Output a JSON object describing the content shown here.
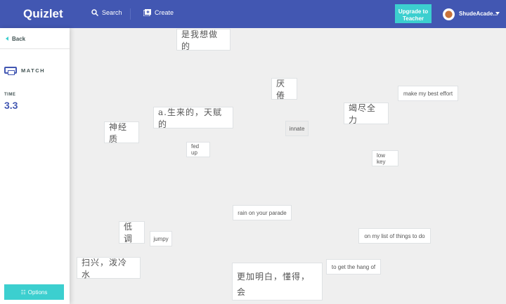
{
  "header": {
    "logo": "Quizlet",
    "search": "Search",
    "create": "Create",
    "upgrade": "Upgrade to Teacher",
    "username": "ShudeAcade..."
  },
  "sidebar": {
    "back": "Back",
    "mode": "MATCH",
    "time_label": "TIME",
    "time_value": "3.3",
    "options": "Options"
  },
  "cards": [
    {
      "text": "是我想做的"
    },
    {
      "text": "厌倦"
    },
    {
      "text": "a.生来的，天赋的"
    },
    {
      "text": "竭尽全力"
    },
    {
      "text": "make my best effort"
    },
    {
      "text": "innate"
    },
    {
      "text": "神经质"
    },
    {
      "text": "fed up"
    },
    {
      "text": "low key"
    },
    {
      "text": "rain on your parade"
    },
    {
      "text": "低调"
    },
    {
      "text": "jumpy"
    },
    {
      "text": "on my list of things to do"
    },
    {
      "text": "扫兴，泼冷水"
    },
    {
      "text": "更加明白，懂得，会"
    },
    {
      "text": "to get the hang of"
    }
  ],
  "colors": {
    "brand": "#4257b2",
    "accent": "#3ccfcf"
  }
}
